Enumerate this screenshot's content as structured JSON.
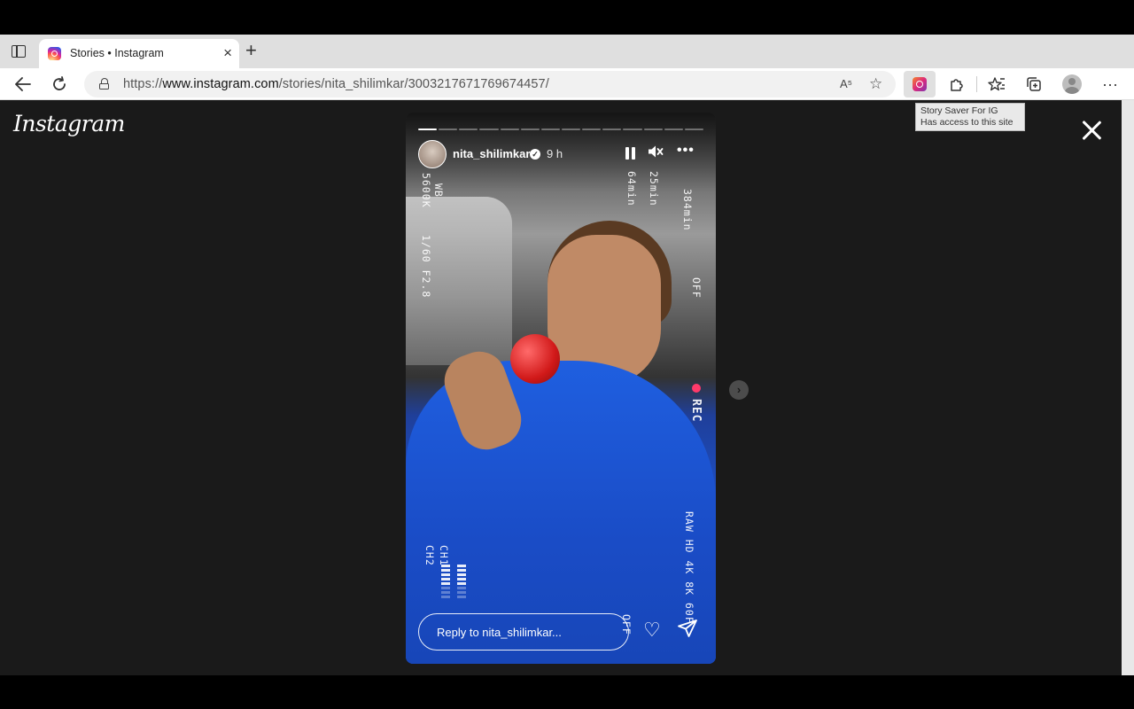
{
  "browser": {
    "tab": {
      "title": "Stories • Instagram",
      "close_glyph": "×"
    },
    "new_tab_glyph": "+",
    "url": {
      "scheme": "https://",
      "host": "www.instagram.com",
      "path": "/stories/nita_shilimkar/3003217671769674457/"
    },
    "read_aloud_glyph": "A⁵",
    "favorite_add_glyph": "☆",
    "extension_tooltip": {
      "line1": "Story Saver For IG",
      "line2": "Has access to this site"
    },
    "menu_glyph": "···"
  },
  "page": {
    "logo_text": "Instagram",
    "story": {
      "progress_segments_total": 14,
      "progress_segments_done": 1,
      "username": "nita_shilimkar",
      "verified_glyph": "✓",
      "time": "9 h",
      "mute_glyph": "🔇",
      "more_glyph": "•••",
      "camera_overlay": {
        "wb": "WB",
        "kelvin": "5600K",
        "shutter_aperture": "1/60   F2.8",
        "time_a": "64min",
        "time_b": "25min",
        "time_c": "384min",
        "stab": "OFF",
        "rec": "REC",
        "formats": "RAW HD 4K 8K 60F",
        "ch1": "CH1",
        "ch2": "CH2",
        "off_label": "OFF"
      },
      "reply_placeholder": "Reply to nita_shilimkar...",
      "like_glyph": "♡"
    },
    "next_glyph": "›"
  }
}
